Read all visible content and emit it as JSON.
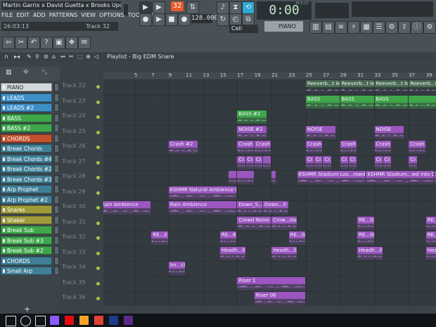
{
  "window": {
    "title": "Martin Garrix x David Guetta x Brooks Upd..."
  },
  "menu": [
    "FILE",
    "EDIT",
    "ADD",
    "PATTERNS",
    "VIEW",
    "OPTIONS",
    "TOOLS",
    "?"
  ],
  "hint": {
    "time": "26:03:13",
    "track": "Track 32"
  },
  "transport": {
    "pattern_number": "32",
    "tempo": "128.000",
    "time_display": "0:00",
    "time_units": "M:S:CS",
    "snap": "Cell",
    "piano_mode": "PIANO"
  },
  "playlist": {
    "title": "Playlist - Big EDM Snare"
  },
  "ruler": [
    5,
    7,
    9,
    11,
    13,
    15,
    17,
    19,
    21,
    23,
    25,
    27,
    29,
    31,
    33,
    35,
    37,
    39,
    41
  ],
  "channels": [
    {
      "name": "PIANO",
      "color": "#d3d9db",
      "text": "#222"
    },
    {
      "name": "LEADS",
      "color": "#3e8fc8",
      "text": "#fff"
    },
    {
      "name": "LEADS #2",
      "color": "#3e8fc8",
      "text": "#fff"
    },
    {
      "name": "BASS",
      "color": "#3fa64a",
      "text": "#fff"
    },
    {
      "name": "BASS #2",
      "color": "#3fa64a",
      "text": "#fff"
    },
    {
      "name": "CHORDS",
      "color": "#c3512e",
      "text": "#fff"
    },
    {
      "name": "Break Chords",
      "color": "#3f7f97",
      "text": "#fff"
    },
    {
      "name": "Break Chords #4",
      "color": "#3f7f97",
      "text": "#fff"
    },
    {
      "name": "Break Chords #2",
      "color": "#3f7f97",
      "text": "#fff"
    },
    {
      "name": "Break Chords #3",
      "color": "#3f7f97",
      "text": "#fff"
    },
    {
      "name": "Arp Prophet",
      "color": "#3f7f97",
      "text": "#fff"
    },
    {
      "name": "Arp Prophet #2",
      "color": "#3f7f97",
      "text": "#fff"
    },
    {
      "name": "Snares",
      "color": "#9f9b3a",
      "text": "#fff"
    },
    {
      "name": "Shaker",
      "color": "#9f9b3a",
      "text": "#fff"
    },
    {
      "name": "Break Sub",
      "color": "#3fa64a",
      "text": "#fff"
    },
    {
      "name": "Break Sub #3",
      "color": "#3fa64a",
      "text": "#fff"
    },
    {
      "name": "Break Sub #2",
      "color": "#3fa64a",
      "text": "#fff"
    },
    {
      "name": "CHORDS",
      "color": "#3f7f97",
      "text": "#fff"
    },
    {
      "name": "Small Arp",
      "color": "#3f7f97",
      "text": "#fff"
    }
  ],
  "tracks": [
    "Track 22",
    "Track 23",
    "Track 24",
    "Track 25",
    "Track 26",
    "Track 27",
    "Track 28",
    "Track 29",
    "Track 30",
    "Track 31",
    "Track 32",
    "Track 33",
    "Track 34",
    "Track 35",
    "Track 36"
  ],
  "clips": [
    {
      "row": 0,
      "start": 25,
      "len": 4,
      "label": "Reeverb...t level",
      "color": "#4a6b52"
    },
    {
      "row": 0,
      "start": 29,
      "len": 4,
      "label": "Reeverb...t level",
      "color": "#4a6b52"
    },
    {
      "row": 0,
      "start": 33,
      "len": 4,
      "label": "Reeverb...t level",
      "color": "#4a6b52"
    },
    {
      "row": 0,
      "start": 37,
      "len": 4,
      "label": "Reeverb...t level",
      "color": "#4a6b52"
    },
    {
      "row": 1,
      "start": 25,
      "len": 4,
      "label": "BASS",
      "color": "#3fa64a"
    },
    {
      "row": 1,
      "start": 29,
      "len": 4,
      "label": "BASS",
      "color": "#3fa64a"
    },
    {
      "row": 1,
      "start": 33,
      "len": 4,
      "label": "BASS",
      "color": "#3fa64a"
    },
    {
      "row": 1,
      "start": 37,
      "len": 4,
      "label": "",
      "color": "#3fa64a"
    },
    {
      "row": 2,
      "start": 17,
      "len": 3.5,
      "label": "BASS #2",
      "color": "#3fa64a"
    },
    {
      "row": 3,
      "start": 17,
      "len": 3.5,
      "label": "NOISE #2",
      "color": "#9b56c0"
    },
    {
      "row": 3,
      "start": 25,
      "len": 3.5,
      "label": "NOISE",
      "color": "#9b56c0"
    },
    {
      "row": 3,
      "start": 33,
      "len": 3.5,
      "label": "NOISE",
      "color": "#9b56c0"
    },
    {
      "row": 3,
      "start": 41,
      "len": 1,
      "label": "",
      "color": "#9b56c0"
    },
    {
      "row": 4,
      "start": 9,
      "len": 3.5,
      "label": "Crash #2",
      "color": "#9b56c0"
    },
    {
      "row": 4,
      "start": 17,
      "len": 2,
      "label": "Crash",
      "color": "#9b56c0"
    },
    {
      "row": 4,
      "start": 19,
      "len": 2,
      "label": "Crash",
      "color": "#9b56c0"
    },
    {
      "row": 4,
      "start": 25,
      "len": 2,
      "label": "Crash",
      "color": "#9b56c0"
    },
    {
      "row": 4,
      "start": 29,
      "len": 2,
      "label": "Crash",
      "color": "#9b56c0"
    },
    {
      "row": 4,
      "start": 33,
      "len": 2,
      "label": "Crash",
      "color": "#9b56c0"
    },
    {
      "row": 4,
      "start": 37,
      "len": 2,
      "label": "Crash",
      "color": "#9b56c0"
    },
    {
      "row": 4,
      "start": 41,
      "len": 1,
      "label": "",
      "color": "#9b56c0"
    },
    {
      "row": 5,
      "start": 17,
      "len": 1,
      "label": "Cr...ts",
      "color": "#9b56c0"
    },
    {
      "row": 5,
      "start": 18,
      "len": 1,
      "label": "Cr...ts",
      "color": "#9b56c0"
    },
    {
      "row": 5,
      "start": 19,
      "len": 1,
      "label": "Cr...ts",
      "color": "#9b56c0"
    },
    {
      "row": 5,
      "start": 20,
      "len": 1,
      "label": "",
      "color": "#9b56c0"
    },
    {
      "row": 5,
      "start": 25,
      "len": 1,
      "label": "Cr...ts",
      "color": "#9b56c0"
    },
    {
      "row": 5,
      "start": 26,
      "len": 1,
      "label": "Cr...ts",
      "color": "#9b56c0"
    },
    {
      "row": 5,
      "start": 27,
      "len": 1,
      "label": "Cr...ts",
      "color": "#9b56c0"
    },
    {
      "row": 5,
      "start": 29,
      "len": 1,
      "label": "Cr...ts",
      "color": "#9b56c0"
    },
    {
      "row": 5,
      "start": 30,
      "len": 1,
      "label": "Cr...ts",
      "color": "#9b56c0"
    },
    {
      "row": 5,
      "start": 33,
      "len": 1,
      "label": "Cr...ts",
      "color": "#9b56c0"
    },
    {
      "row": 5,
      "start": 34,
      "len": 1,
      "label": "Cr...ts",
      "color": "#9b56c0"
    },
    {
      "row": 5,
      "start": 37,
      "len": 1,
      "label": "Cr...ts",
      "color": "#9b56c0"
    },
    {
      "row": 5,
      "start": 41,
      "len": 1,
      "label": "",
      "color": "#9b56c0"
    },
    {
      "row": 6,
      "start": 16,
      "len": 1,
      "label": "",
      "color": "#9b56c0"
    },
    {
      "row": 6,
      "start": 17,
      "len": 2,
      "label": "",
      "color": "#9b56c0"
    },
    {
      "row": 6,
      "start": 21,
      "len": 0.5,
      "label": "",
      "color": "#9b56c0"
    },
    {
      "row": 6,
      "start": 24,
      "len": 8,
      "label": "KSHMR Stadium Loo...rowd into Claps",
      "color": "#9b56c0"
    },
    {
      "row": 6,
      "start": 32,
      "len": 8,
      "label": "KSHMR Stadium...wd into Claps",
      "color": "#9b56c0"
    },
    {
      "row": 6,
      "start": 40,
      "len": 2,
      "label": "KSHMR",
      "color": "#9b56c0"
    },
    {
      "row": 7,
      "start": 9,
      "len": 8,
      "label": "KSHMR Natural Ambience 04 - Ocean",
      "color": "#9b56c0"
    },
    {
      "row": 8,
      "start": 1,
      "len": 6,
      "label": "Rain Ambience",
      "color": "#9b56c0"
    },
    {
      "row": 8,
      "start": 9,
      "len": 8,
      "label": "Rain Ambience",
      "color": "#9b56c0"
    },
    {
      "row": 8,
      "start": 17,
      "len": 3,
      "label": "Down_S...FX 04",
      "color": "#9b56c0"
    },
    {
      "row": 8,
      "start": 20,
      "len": 3,
      "label": "Down...X 04",
      "color": "#9b56c0"
    },
    {
      "row": 9,
      "start": 17,
      "len": 4,
      "label": "Crowd Noise",
      "color": "#9b56c0"
    },
    {
      "row": 9,
      "start": 21,
      "len": 3,
      "label": "Crow...oise",
      "color": "#9b56c0"
    },
    {
      "row": 9,
      "start": 31,
      "len": 2,
      "label": "RE...02",
      "color": "#9b56c0"
    },
    {
      "row": 9,
      "start": 39,
      "len": 2,
      "label": "RE...02",
      "color": "#9b56c0"
    },
    {
      "row": 10,
      "start": 7,
      "len": 2,
      "label": "RE...2",
      "color": "#9b56c0"
    },
    {
      "row": 10,
      "start": 15,
      "len": 2,
      "label": "RE...8",
      "color": "#9b56c0"
    },
    {
      "row": 10,
      "start": 23,
      "len": 2,
      "label": "RE...08",
      "color": "#9b56c0"
    },
    {
      "row": 10,
      "start": 31,
      "len": 2,
      "label": "RE...08",
      "color": "#9b56c0"
    },
    {
      "row": 10,
      "start": 39,
      "len": 2,
      "label": "RE...08",
      "color": "#9b56c0"
    },
    {
      "row": 11,
      "start": 15,
      "len": 3,
      "label": "Headh...llp",
      "color": "#9b56c0"
    },
    {
      "row": 11,
      "start": 21,
      "len": 3,
      "label": "Headh...llp",
      "color": "#9b56c0"
    },
    {
      "row": 11,
      "start": 31,
      "len": 3,
      "label": "Headh...llp",
      "color": "#9b56c0"
    },
    {
      "row": 11,
      "start": 39,
      "len": 3,
      "label": "Headh...llp",
      "color": "#9b56c0"
    },
    {
      "row": 12,
      "start": 9,
      "len": 2,
      "label": "Im...ct",
      "color": "#9b56c0"
    },
    {
      "row": 13,
      "start": 17,
      "len": 8,
      "label": "Riser 1",
      "color": "#9b56c0"
    },
    {
      "row": 14,
      "start": 19,
      "len": 6,
      "label": "Riser 06",
      "color": "#9b56c0"
    },
    {
      "row": 15,
      "start": 17,
      "len": 6,
      "label": "Ralph Cowell Riser 10",
      "color": "#9b56c0"
    }
  ],
  "taskbar_icons": [
    "windows-start",
    "cortana",
    "task-view",
    "store",
    "netflix",
    "fl-studio",
    "chrome",
    "photoshop",
    "premiere"
  ]
}
